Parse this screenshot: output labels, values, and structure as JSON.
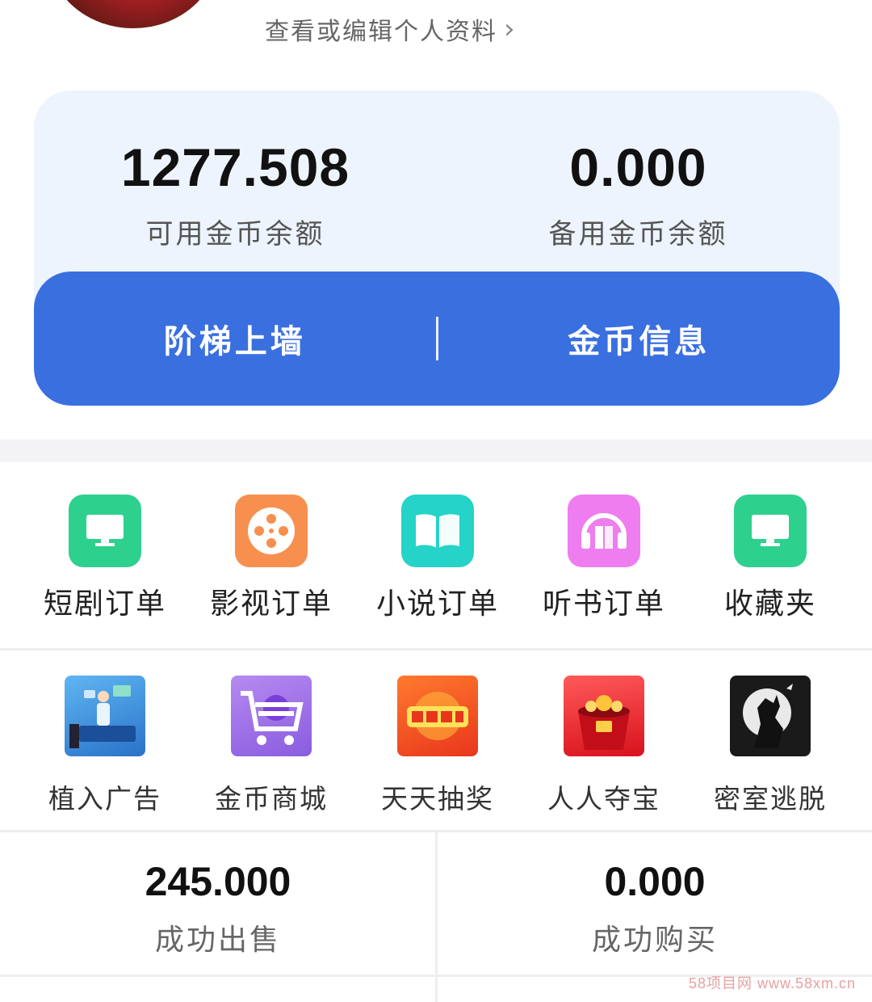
{
  "profile": {
    "link_text": "查看或编辑个人资料",
    "chevron": "›"
  },
  "wallet": {
    "available": {
      "value": "1277.508",
      "label": "可用金币余额"
    },
    "backup": {
      "value": "0.000",
      "label": "备用金币余额"
    },
    "actions": [
      "阶梯上墙",
      "金币信息"
    ],
    "accent_color": "#3a6fe0"
  },
  "menu_row1": [
    {
      "label": "短剧订单",
      "icon": "monitor-icon",
      "color": "#2ed08d"
    },
    {
      "label": "影视订单",
      "icon": "film-reel-icon",
      "color": "#f7904f"
    },
    {
      "label": "小说订单",
      "icon": "book-icon",
      "color": "#26d3c8"
    },
    {
      "label": "听书订单",
      "icon": "headphones-book-icon",
      "color": "#ee7df0"
    },
    {
      "label": "收藏夹",
      "icon": "monitor-icon",
      "color": "#2ed08d"
    }
  ],
  "menu_row2": [
    {
      "label": "植入广告",
      "icon": "ad-illustration-icon"
    },
    {
      "label": "金币商城",
      "icon": "shopping-cart-icon"
    },
    {
      "label": "天天抽奖",
      "icon": "lottery-icon"
    },
    {
      "label": "人人夺宝",
      "icon": "treasure-bag-icon"
    },
    {
      "label": "密室逃脱",
      "icon": "werewolf-moon-icon"
    }
  ],
  "stats": {
    "sold": {
      "value": "245.000",
      "label": "成功出售"
    },
    "bought": {
      "value": "0.000",
      "label": "成功购买"
    }
  },
  "watermark": "58项目网 www.58xm.cn"
}
